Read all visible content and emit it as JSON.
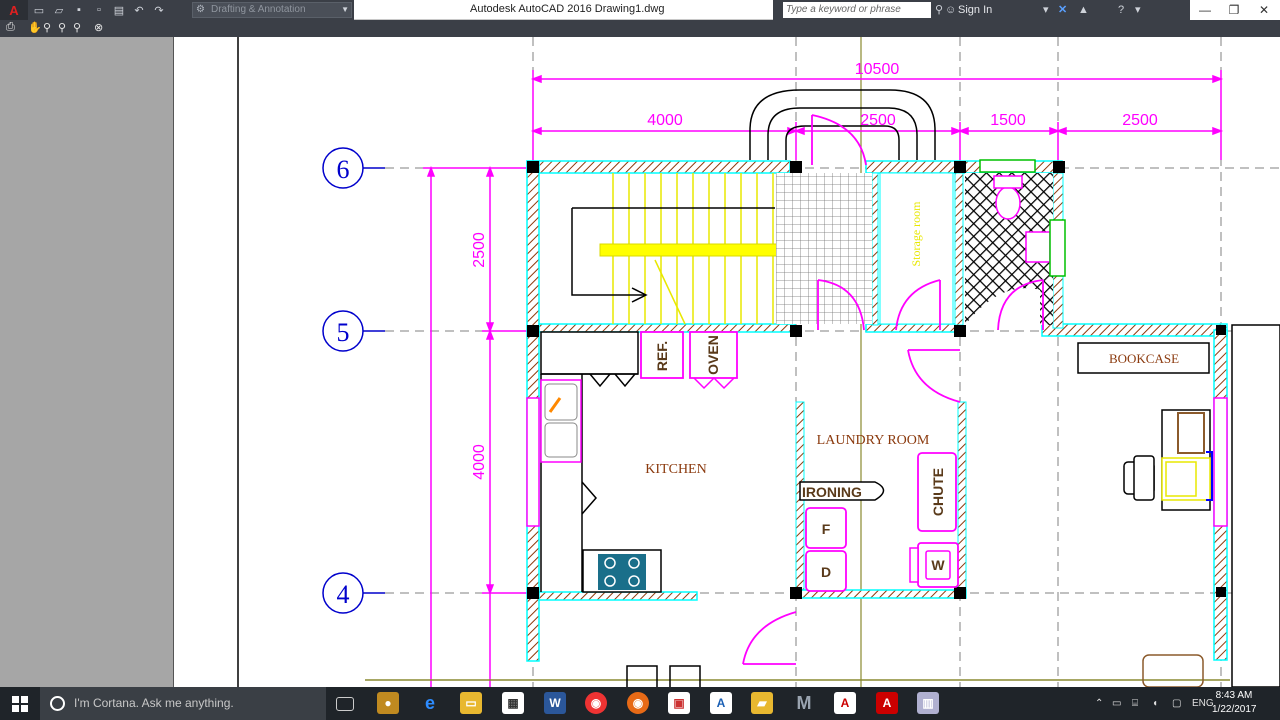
{
  "app": {
    "title": "Autodesk AutoCAD 2016    Drawing1.dwg",
    "workspace": "Drafting & Annotation",
    "search_placeholder": "Type a keyword or phrase",
    "sign_in": "Sign In"
  },
  "drawing": {
    "grid_labels": [
      "6",
      "5",
      "4"
    ],
    "dims": {
      "overall_width": "10500",
      "seg1": "4000",
      "seg2": "2500",
      "seg3": "1500",
      "seg4": "2500",
      "vert1": "2500",
      "vert2": "4000"
    },
    "rooms": {
      "kitchen": "KITCHEN",
      "laundry": "LAUNDRY ROOM",
      "bookcase": "BOOKCASE",
      "storage": "Storage room"
    },
    "fixtures": {
      "ref": "REF.",
      "oven": "OVEN",
      "ironing": "IRONING",
      "chute": "CHUTE",
      "f": "F",
      "d": "D",
      "w": "W"
    },
    "colors": {
      "magenta": "#ff00ff",
      "cyan": "#00ffff",
      "blue": "#0000cc",
      "yellow": "#ffff00",
      "brown": "#8b3a0e",
      "gridline": "#808080"
    }
  },
  "taskbar": {
    "cortana": "I'm Cortana. Ask me anything.",
    "lang": "ENG",
    "time": "8:43 AM",
    "date": "1/22/2017"
  }
}
